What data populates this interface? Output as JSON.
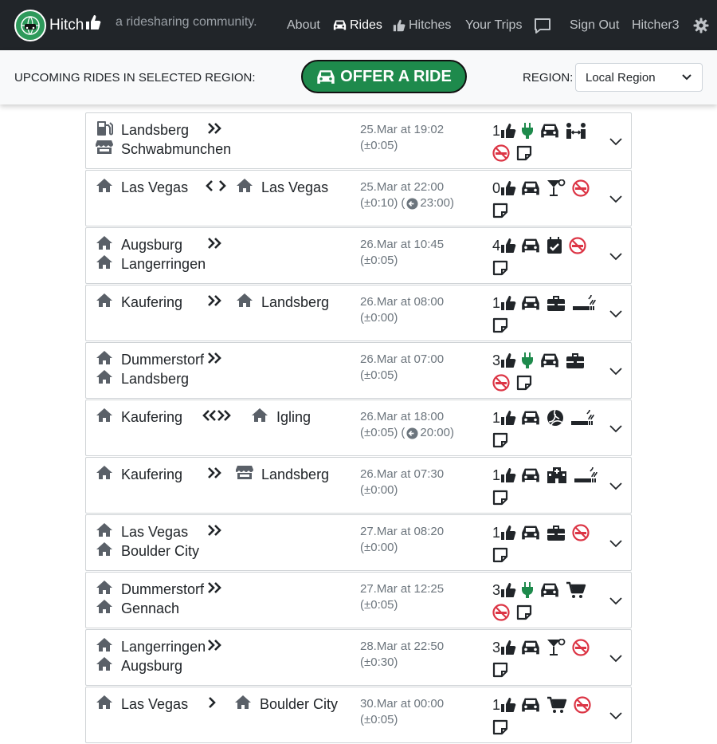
{
  "app": {
    "name": "Hitch",
    "tagline": "a ridesharing community."
  },
  "nav": {
    "about": "About",
    "rides": "Rides",
    "hitches": "Hitches",
    "your_trips": "Your Trips",
    "sign_out": "Sign Out",
    "username": "Hitcher3"
  },
  "subbar": {
    "label": "UPCOMING RIDES IN SELECTED REGION:",
    "offer_button": "OFFER A RIDE",
    "region_label": "REGION:",
    "region_value": "Local Region"
  },
  "colors": {
    "green": "#1e8a4c",
    "red": "#dc3545",
    "navbar": "#212529"
  },
  "rides": [
    {
      "from": "Landsberg",
      "from_icon": "gas-station-icon",
      "to": "Schwabmunchen",
      "to_icon": "store-icon",
      "arrow": "»",
      "date": "25.Mar at 19:02",
      "tolerance": "(±0:05)",
      "return": "",
      "likes": "1",
      "features": [
        "charger-icon",
        "car-icon",
        "people-arrows-icon",
        "no-smoking-icon",
        "note-icon"
      ]
    },
    {
      "from": "Las Vegas",
      "from_icon": "home-icon",
      "to": "Las Vegas",
      "to_icon": "home-icon",
      "arrow": "<>",
      "date": "25.Mar at 22:00",
      "tolerance": "(±0:10)",
      "return": "23:00",
      "likes": "0",
      "features": [
        "car-icon",
        "cocktail-icon",
        "no-smoking-icon",
        "note-icon"
      ]
    },
    {
      "from": "Augsburg",
      "from_icon": "home-icon",
      "to": "Langerringen",
      "to_icon": "home-icon",
      "arrow": "»",
      "date": "26.Mar at 10:45",
      "tolerance": "(±0:05)",
      "return": "",
      "likes": "4",
      "features": [
        "car-icon",
        "calendar-check-icon",
        "no-smoking-icon",
        "note-icon"
      ]
    },
    {
      "from": "Kaufering",
      "from_icon": "home-icon",
      "to": "Landsberg",
      "to_icon": "home-icon",
      "arrow": "»",
      "date": "26.Mar at 08:00",
      "tolerance": "(±0:00)",
      "return": "",
      "likes": "1",
      "features": [
        "car-icon",
        "briefcase-icon",
        "smoking-icon",
        "note-icon"
      ]
    },
    {
      "from": "Dummerstorf",
      "from_icon": "home-icon",
      "to": "Landsberg",
      "to_icon": "home-icon",
      "arrow": "»",
      "date": "26.Mar at 07:00",
      "tolerance": "(±0:05)",
      "return": "",
      "likes": "3",
      "features": [
        "charger-icon",
        "car-icon",
        "briefcase-icon",
        "no-smoking-icon",
        "note-icon"
      ]
    },
    {
      "from": "Kaufering",
      "from_icon": "home-icon",
      "to": "Igling",
      "to_icon": "home-icon",
      "arrow": "«»",
      "date": "26.Mar at 18:00",
      "tolerance": "(±0:05)",
      "return": "20:00",
      "likes": "1",
      "features": [
        "car-icon",
        "volleyball-icon",
        "smoking-icon",
        "note-icon"
      ]
    },
    {
      "from": "Kaufering",
      "from_icon": "home-icon",
      "to": "Landsberg",
      "to_icon": "store-icon",
      "arrow": "»",
      "date": "26.Mar at 07:30",
      "tolerance": "(±0:00)",
      "return": "",
      "likes": "1",
      "features": [
        "car-icon",
        "hospital-icon",
        "smoking-icon",
        "note-icon"
      ]
    },
    {
      "from": "Las Vegas",
      "from_icon": "home-icon",
      "to": "Boulder City",
      "to_icon": "home-icon",
      "arrow": "»",
      "date": "27.Mar at 08:20",
      "tolerance": "(±0:00)",
      "return": "",
      "likes": "1",
      "features": [
        "car-icon",
        "briefcase-icon",
        "no-smoking-icon",
        "note-icon"
      ]
    },
    {
      "from": "Dummerstorf",
      "from_icon": "home-icon",
      "to": "Gennach",
      "to_icon": "home-icon",
      "arrow": "»",
      "date": "27.Mar at 12:25",
      "tolerance": "(±0:05)",
      "return": "",
      "likes": "3",
      "features": [
        "charger-icon",
        "car-icon",
        "cart-icon",
        "no-smoking-icon",
        "note-icon"
      ]
    },
    {
      "from": "Langerringen",
      "from_icon": "home-icon",
      "to": "Augsburg",
      "to_icon": "home-icon",
      "arrow": "»",
      "date": "28.Mar at 22:50",
      "tolerance": "(±0:30)",
      "return": "",
      "likes": "3",
      "features": [
        "car-icon",
        "cocktail-icon",
        "no-smoking-icon",
        "note-icon"
      ]
    },
    {
      "from": "Las Vegas",
      "from_icon": "home-icon",
      "to": "Boulder City",
      "to_icon": "home-icon",
      "arrow": ">",
      "date": "30.Mar at 00:00",
      "tolerance": "(±0:05)",
      "return": "",
      "likes": "1",
      "features": [
        "car-icon",
        "cart-icon",
        "no-smoking-icon",
        "note-icon"
      ]
    }
  ]
}
